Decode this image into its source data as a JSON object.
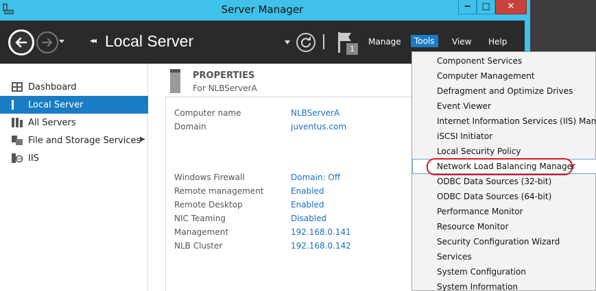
{
  "window": {
    "title": "Server Manager"
  },
  "window_controls": {
    "minimize": "‒",
    "maximize": "□",
    "close": "✕"
  },
  "header": {
    "breadcrumb_arrows": "◂◂",
    "page_title": "Local Server",
    "notification_count": "1",
    "menus": {
      "manage": "Manage",
      "tools": "Tools",
      "view": "View",
      "help": "Help"
    }
  },
  "sidebar": {
    "items": [
      {
        "label": "Dashboard",
        "icon": "dashboard-icon"
      },
      {
        "label": "Local Server",
        "icon": "server-icon",
        "active": true
      },
      {
        "label": "All Servers",
        "icon": "servers-icon"
      },
      {
        "label": "File and Storage Services",
        "icon": "storage-icon",
        "has_submenu": true
      },
      {
        "label": "IIS",
        "icon": "iis-icon"
      }
    ]
  },
  "properties": {
    "title": "PROPERTIES",
    "subtitle": "For NLBServerA",
    "rows": [
      {
        "key": "Computer name",
        "value": "NLBServerA"
      },
      {
        "key": "Domain",
        "value": "juventus.com"
      },
      {
        "key": "Windows Firewall",
        "value": "Domain: Off"
      },
      {
        "key": "Remote management",
        "value": "Enabled"
      },
      {
        "key": "Remote Desktop",
        "value": "Enabled"
      },
      {
        "key": "NIC Teaming",
        "value": "Disabled"
      },
      {
        "key": "Management",
        "value": "192.168.0.141"
      },
      {
        "key": "NLB Cluster",
        "value": "192.168.0.142"
      }
    ]
  },
  "tools_menu": {
    "items": [
      "Component Services",
      "Computer Management",
      "Defragment and Optimize Drives",
      "Event Viewer",
      "Internet Information Services (IIS) Manager",
      "iSCSI Initiator",
      "Local Security Policy",
      "Network Load Balancing Manager",
      "ODBC Data Sources (32-bit)",
      "ODBC Data Sources (64-bit)",
      "Performance Monitor",
      "Resource Monitor",
      "Security Configuration Wizard",
      "Services",
      "System Configuration",
      "System Information"
    ],
    "hovered_item": "Network Load Balancing Manager"
  },
  "colors": {
    "titlebar": "#3fc1ea",
    "header": "#2a2a2a",
    "accent": "#1a7dc4",
    "link": "#1a6fc4",
    "highlight": "#d9161e"
  }
}
